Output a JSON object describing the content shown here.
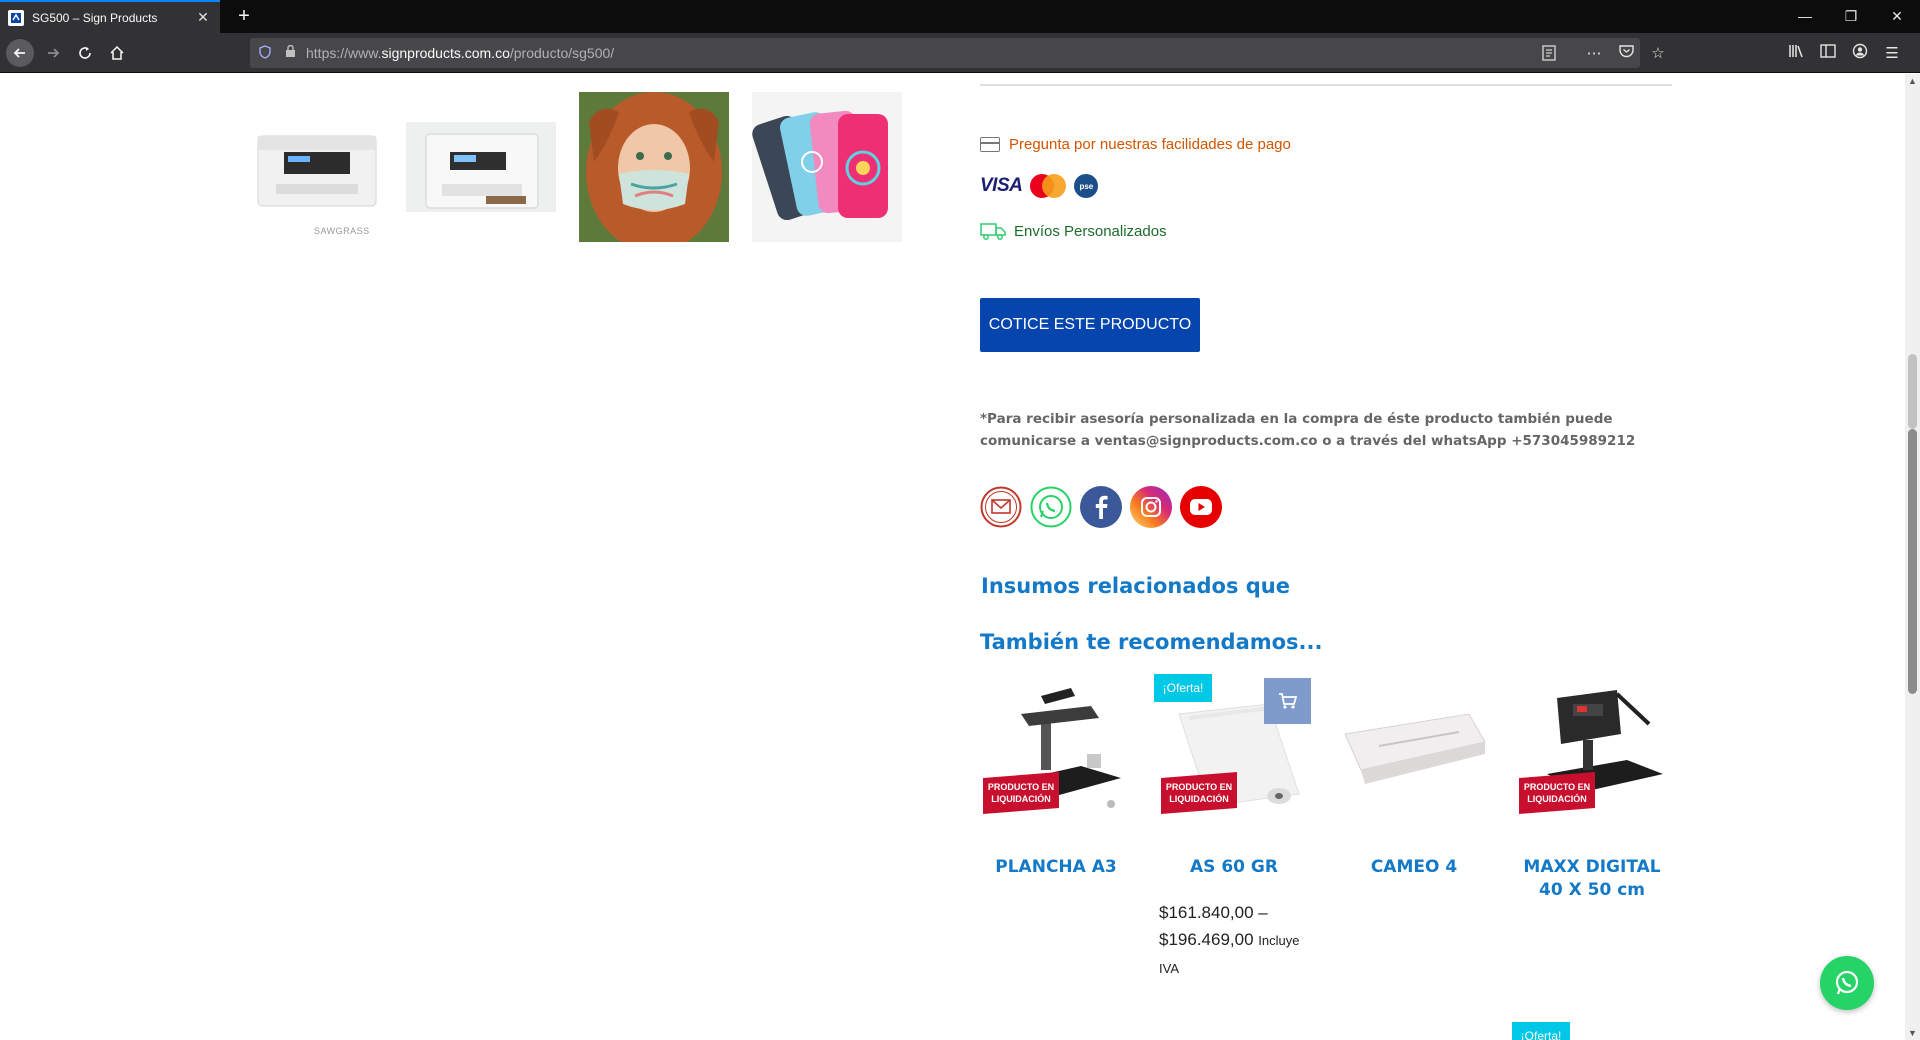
{
  "browser": {
    "tab_title": "SG500 – Sign Products",
    "url_prefix": "https://www.",
    "url_host": "signproducts.com.co",
    "url_path": "/producto/sg500/",
    "new_tab_glyph": "+",
    "close_glyph": "✕"
  },
  "gallery": {
    "thumbs": [
      "printer-front",
      "printer-angle",
      "person-with-mask",
      "phone-cases"
    ],
    "brand_caption": "SAWGRASS"
  },
  "payment": {
    "text": "Pregunta por nuestras facilidades de pago",
    "visa_label": "VISA",
    "pse_label": "pse"
  },
  "shipping": {
    "text": "Envíos Personalizados"
  },
  "cta": {
    "label": "COTICE ESTE PRODUCTO"
  },
  "advice": {
    "text": "*Para recibir asesoría personalizada en la compra de éste producto también puede comunicarse a ventas@signproducts.com.co o a través del whatsApp +573045989212"
  },
  "social": {
    "icons": [
      "email-icon",
      "whatsapp-icon",
      "facebook-icon",
      "instagram-icon",
      "youtube-icon"
    ]
  },
  "related": {
    "heading": "Insumos relacionados que",
    "recommend_heading": "También te recomendamos..."
  },
  "products": [
    {
      "name": "PLANCHA A3",
      "badge": "PRODUCTO EN LIQUIDACIÓN"
    },
    {
      "name": "AS 60 GR",
      "badge": "PRODUCTO EN LIQUIDACIÓN",
      "price_line1": "$161.840,00 –",
      "price_line2": "$196.469,00",
      "price_suffix": "Incluye",
      "price_suffix2": "IVA"
    },
    {
      "name": "CAMEO 4"
    },
    {
      "name": "MAXX DIGITAL 40 X 50 cm",
      "badge": "PRODUCTO EN LIQUIDACIÓN"
    }
  ],
  "sale_badge": "¡Oferta!",
  "liq_line1": "PRODUCTO EN",
  "liq_line2": "LIQUIDACIÓN",
  "colors": {
    "accent_blue": "#1479c6",
    "cta_blue": "#0645ad",
    "oferta_cyan": "#00c8e6",
    "payment_orange": "#d35400",
    "whatsapp_green": "#25d366"
  }
}
